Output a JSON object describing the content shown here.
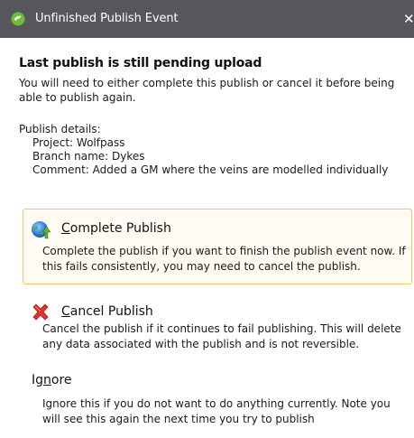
{
  "window": {
    "title": "Unfinished Publish Event",
    "close_glyph": "✕",
    "icon": "leapfrog-app-icon"
  },
  "heading": "Last publish is still pending upload",
  "intro": "You will need to either complete this publish or cancel it before being able to publish again.",
  "details": {
    "label": "Publish details:",
    "project": "Project: Wolfpass",
    "branch": "Branch name: Dykes",
    "comment": "Comment: Added a GM where the veins are modelled individually"
  },
  "options": {
    "complete": {
      "mnemonic": "C",
      "rest": "omplete Publish",
      "description": "Complete the publish if you want to finish the publish event now. If this fails consistently, you may need to cancel the publish.",
      "icon": "globe-upload-icon",
      "selected": true
    },
    "cancel": {
      "mnemonic": "C",
      "rest": "ancel Publish",
      "description": "Cancel the publish if it continues to fail publishing. This will delete any data associated with the publish and is not reversible.",
      "icon": "red-x-icon"
    },
    "ignore": {
      "prefix": "Ig",
      "mnemonic": "n",
      "rest": "ore",
      "description": "Ignore this if you do not want to do anything currently. Note you will see this again the next time you try to publish"
    }
  },
  "colors": {
    "titlebar": "#55575a",
    "selected_border": "#f0c66a",
    "selected_bg": "#fffbf3",
    "cancel_red": "#e0332a",
    "globe_blue": "#2f7fd6",
    "arrow_green": "#5cb531"
  }
}
